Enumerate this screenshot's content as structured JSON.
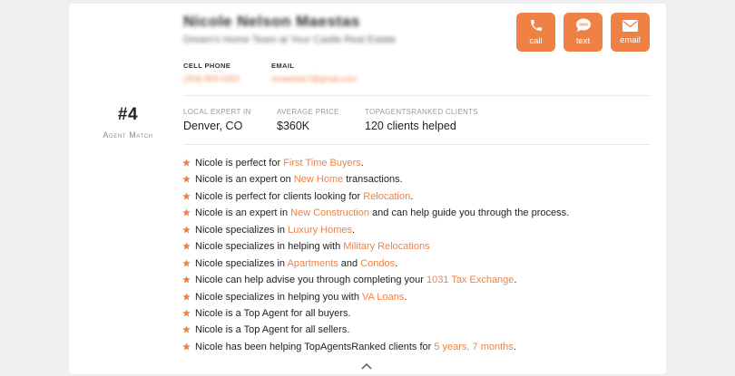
{
  "agent": {
    "name": "Nicole Nelson Maestas",
    "subtitle": "Dream's Home Team at Your Castle Real Estate",
    "rank": "#4",
    "rank_label": "Agent Match"
  },
  "contact_buttons": [
    {
      "label": "call",
      "icon": "phone-icon"
    },
    {
      "label": "text",
      "icon": "sms-bubble-icon",
      "icon_text": "SMS"
    },
    {
      "label": "email",
      "icon": "envelope-icon"
    }
  ],
  "contact": {
    "cell_label": "CELL PHONE",
    "cell_value": "(303) 809-0353",
    "email_label": "EMAIL",
    "email_value": "nmaestas7@gmail.com"
  },
  "stats": [
    {
      "label": "LOCAL EXPERT IN",
      "value": "Denver, CO"
    },
    {
      "label": "AVERAGE PRICE",
      "value": "$360K"
    },
    {
      "label": "TOPAGENTSRANKED CLIENTS",
      "value": "120 clients helped"
    }
  ],
  "facts": [
    {
      "parts": [
        {
          "t": "Nicole is perfect for "
        },
        {
          "t": "First Time Buyers",
          "hl": true
        },
        {
          "t": "."
        }
      ]
    },
    {
      "parts": [
        {
          "t": "Nicole is an expert on "
        },
        {
          "t": "New Home",
          "hl": true
        },
        {
          "t": " transactions."
        }
      ]
    },
    {
      "parts": [
        {
          "t": "Nicole is perfect for clients looking for "
        },
        {
          "t": "Relocation",
          "hl": true
        },
        {
          "t": "."
        }
      ]
    },
    {
      "parts": [
        {
          "t": "Nicole is an expert in "
        },
        {
          "t": "New Construction",
          "hl": true
        },
        {
          "t": " and can help guide you through the process."
        }
      ]
    },
    {
      "parts": [
        {
          "t": "Nicole specializes in "
        },
        {
          "t": "Luxury Homes",
          "hl": true
        },
        {
          "t": "."
        }
      ]
    },
    {
      "parts": [
        {
          "t": "Nicole specializes in helping with "
        },
        {
          "t": "Military Relocations",
          "hl": true
        }
      ]
    },
    {
      "parts": [
        {
          "t": "Nicole specializes in "
        },
        {
          "t": "Apartments",
          "hl": true
        },
        {
          "t": " and "
        },
        {
          "t": "Condos",
          "hl": true
        },
        {
          "t": "."
        }
      ]
    },
    {
      "parts": [
        {
          "t": "Nicole can help advise you through completing your "
        },
        {
          "t": "1031 Tax Exchange",
          "hl": true
        },
        {
          "t": "."
        }
      ]
    },
    {
      "parts": [
        {
          "t": "Nicole specializes in helping you with "
        },
        {
          "t": "VA Loans",
          "hl": true
        },
        {
          "t": "."
        }
      ]
    },
    {
      "parts": [
        {
          "t": "Nicole is a Top Agent for all buyers."
        }
      ]
    },
    {
      "parts": [
        {
          "t": "Nicole is a Top Agent for all sellers."
        }
      ]
    },
    {
      "parts": [
        {
          "t": "Nicole has been helping TopAgentsRanked clients for "
        },
        {
          "t": "5 years, 7 months",
          "hl": true
        },
        {
          "t": "."
        }
      ]
    }
  ],
  "collapse_icon": "chevron-up-icon",
  "colors": {
    "accent": "#f08145",
    "background": "#f0f0f0",
    "card": "#ffffff"
  }
}
